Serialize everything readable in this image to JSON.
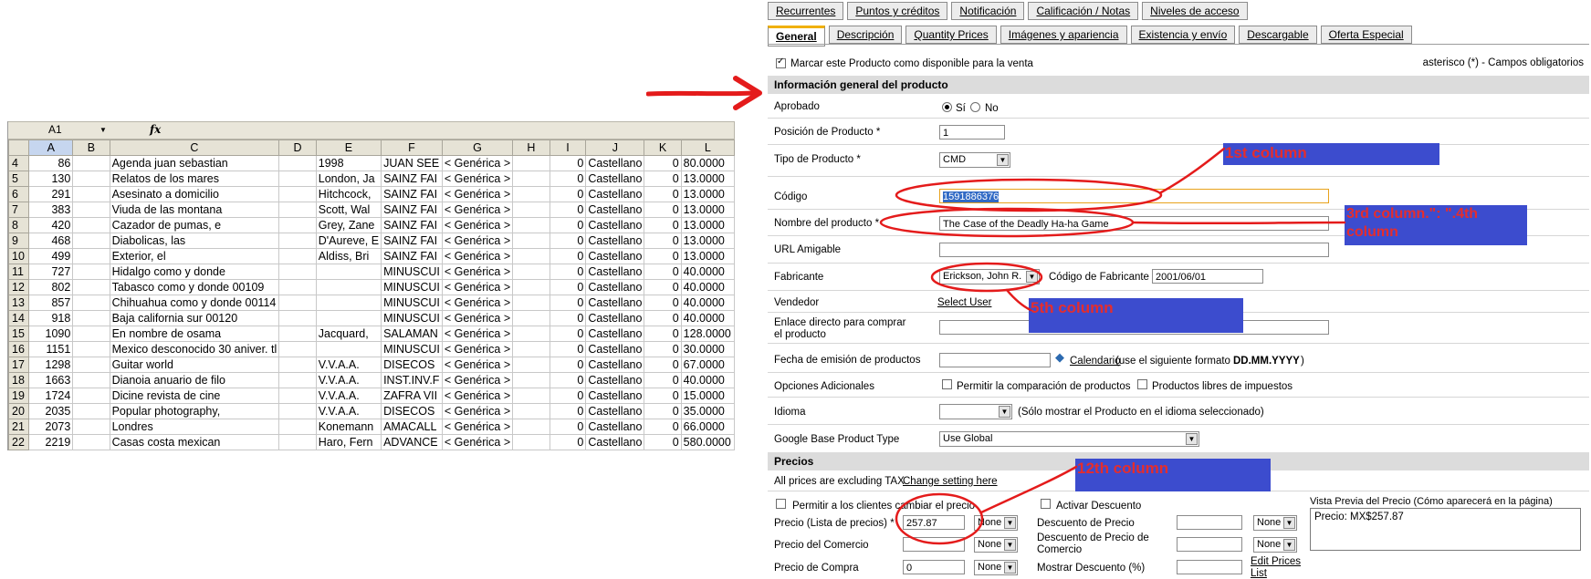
{
  "sheet": {
    "name_box": "A1",
    "fx": "fx",
    "columns": [
      "A",
      "B",
      "C",
      "D",
      "E",
      "F",
      "G",
      "H",
      "I",
      "J",
      "K",
      "L"
    ],
    "rows": [
      {
        "n": "4",
        "a": "86",
        "c": "Agenda juan sebastian",
        "e": "1998",
        "f": "JUAN SEE",
        "g": "< Genérica >",
        "i": "0",
        "j": "Castellano",
        "k": "0",
        "l": "80.0000"
      },
      {
        "n": "5",
        "a": "130",
        "c": "Relatos de los mares",
        "e": "London, Ja",
        "f": "SAINZ FAI",
        "g": "< Genérica >",
        "i": "0",
        "j": "Castellano",
        "k": "0",
        "l": "13.0000"
      },
      {
        "n": "6",
        "a": "291",
        "c": "Asesinato a domicilio",
        "e": "Hitchcock,",
        "f": "SAINZ FAI",
        "g": "< Genérica >",
        "i": "0",
        "j": "Castellano",
        "k": "0",
        "l": "13.0000"
      },
      {
        "n": "7",
        "a": "383",
        "c": "Viuda de las montana",
        "e": "Scott, Wal",
        "f": "SAINZ FAI",
        "g": "< Genérica >",
        "i": "0",
        "j": "Castellano",
        "k": "0",
        "l": "13.0000"
      },
      {
        "n": "8",
        "a": "420",
        "c": "Cazador de pumas, e",
        "e": "Grey, Zane",
        "f": "SAINZ FAI",
        "g": "< Genérica >",
        "i": "0",
        "j": "Castellano",
        "k": "0",
        "l": "13.0000"
      },
      {
        "n": "9",
        "a": "468",
        "c": "Diabolicas, las",
        "e": "D'Aureve, E",
        "f": "SAINZ FAI",
        "g": "< Genérica >",
        "i": "0",
        "j": "Castellano",
        "k": "0",
        "l": "13.0000"
      },
      {
        "n": "10",
        "a": "499",
        "c": "Exterior, el",
        "e": "Aldiss, Bri",
        "f": "SAINZ FAI",
        "g": "< Genérica >",
        "i": "0",
        "j": "Castellano",
        "k": "0",
        "l": "13.0000"
      },
      {
        "n": "11",
        "a": "727",
        "c": "Hidalgo como y donde",
        "e": "",
        "f": "MINUSCUI",
        "g": "< Genérica >",
        "i": "0",
        "j": "Castellano",
        "k": "0",
        "l": "40.0000"
      },
      {
        "n": "12",
        "a": "802",
        "c": "Tabasco como y donde 00109",
        "e": "",
        "f": "MINUSCUI",
        "g": "< Genérica >",
        "i": "0",
        "j": "Castellano",
        "k": "0",
        "l": "40.0000"
      },
      {
        "n": "13",
        "a": "857",
        "c": "Chihuahua como y donde 00114",
        "e": "",
        "f": "MINUSCUI",
        "g": "< Genérica >",
        "i": "0",
        "j": "Castellano",
        "k": "0",
        "l": "40.0000"
      },
      {
        "n": "14",
        "a": "918",
        "c": "Baja california sur 00120",
        "e": "",
        "f": "MINUSCUI",
        "g": "< Genérica >",
        "i": "0",
        "j": "Castellano",
        "k": "0",
        "l": "40.0000"
      },
      {
        "n": "15",
        "a": "1090",
        "c": "En nombre de osama",
        "e": "Jacquard,",
        "f": "SALAMAN",
        "g": "< Genérica >",
        "i": "0",
        "j": "Castellano",
        "k": "0",
        "l": "128.0000"
      },
      {
        "n": "16",
        "a": "1151",
        "c": "Mexico desconocido 30 aniver. tl",
        "e": "",
        "f": "MINUSCUI",
        "g": "< Genérica >",
        "i": "0",
        "j": "Castellano",
        "k": "0",
        "l": "30.0000"
      },
      {
        "n": "17",
        "a": "1298",
        "c": "Guitar world",
        "e": "V.V.A.A.",
        "f": "DISECOS",
        "g": "< Genérica >",
        "i": "0",
        "j": "Castellano",
        "k": "0",
        "l": "67.0000"
      },
      {
        "n": "18",
        "a": "1663",
        "c": "Dianoia anuario de filo",
        "e": "V.V.A.A.",
        "f": "INST.INV.F",
        "g": "< Genérica >",
        "i": "0",
        "j": "Castellano",
        "k": "0",
        "l": "40.0000"
      },
      {
        "n": "19",
        "a": "1724",
        "c": "Dicine revista de cine",
        "e": "V.V.A.A.",
        "f": "ZAFRA VII",
        "g": "< Genérica >",
        "i": "0",
        "j": "Castellano",
        "k": "0",
        "l": "15.0000"
      },
      {
        "n": "20",
        "a": "2035",
        "c": "Popular photography,",
        "e": "V.V.A.A.",
        "f": "DISECOS",
        "g": "< Genérica >",
        "i": "0",
        "j": "Castellano",
        "k": "0",
        "l": "35.0000"
      },
      {
        "n": "21",
        "a": "2073",
        "c": "Londres",
        "e": "Konemann",
        "f": "AMACALL",
        "g": "< Genérica >",
        "i": "0",
        "j": "Castellano",
        "k": "0",
        "l": "66.0000"
      },
      {
        "n": "22",
        "a": "2219",
        "c": "Casas costa mexican",
        "e": "Haro, Fern",
        "f": "ADVANCE",
        "g": "< Genérica >",
        "i": "0",
        "j": "Castellano",
        "k": "0",
        "l": "580.0000"
      }
    ]
  },
  "form": {
    "tabs_row1": [
      "Recurrentes",
      "Puntos y créditos",
      "Notificación",
      "Calificación / Notas",
      "Niveles de acceso"
    ],
    "tabs_row2": [
      "General",
      "Descripción",
      "Quantity Prices",
      "Imágenes y apariencia",
      "Existencia y envío",
      "Descargable",
      "Oferta Especial"
    ],
    "available_label": "Marcar este Producto como disponible para la venta",
    "required_note": "asterisco (*) - Campos obligatorios",
    "section_general": "Información general del producto",
    "aprobado": "Aprobado",
    "si": "Sí",
    "no": "No",
    "posicion_label": "Posición de Producto *",
    "posicion_value": "1",
    "tipo_label": "Tipo de Producto *",
    "tipo_value": "CMD",
    "codigo_label": "Código",
    "codigo_value": "1591886376",
    "nombre_label": "Nombre del producto *",
    "nombre_value": "The Case of the Deadly Ha-ha Game",
    "url_label": "URL Amigable",
    "fabricante_label": "Fabricante",
    "fabricante_value": "Erickson, John R.",
    "codigo_fab_label": "Código de Fabricante",
    "codigo_fab_value": "2001/06/01",
    "vendedor_label": "Vendedor",
    "select_user": "Select User",
    "enlace_label": "Enlace directo para comprar el producto",
    "fecha_label": "Fecha de emisión de productos",
    "calendario": "Calendario",
    "fecha_hint": "(use el siguiente formato",
    "fecha_format": "DD.MM.YYYY",
    "fecha_close": ")",
    "opciones_label": "Opciones Adicionales",
    "comparar": "Permitir la comparación de productos",
    "libres": "Productos libres de impuestos",
    "idioma_label": "Idioma",
    "idioma_hint": "(Sólo mostrar el Producto en el idioma seleccionado)",
    "google_label": "Google Base Product Type",
    "google_value": "Use Global",
    "section_precios": "Precios",
    "tax_note": "All prices are excluding TAX",
    "change_setting": "Change setting here",
    "permitir_cambiar": "Permitir a los clientes cambiar el precio",
    "activar_descuento": "Activar Descuento",
    "vista_previa": "Vista Previa del Precio (Cómo aparecerá en la página)",
    "precio_lista_label": "Precio (Lista de precios) *",
    "precio_lista_value": "257.87",
    "none": "None",
    "descuento_precio": "Descuento de Precio",
    "precio_preview": "Precio:  MX$257.87",
    "precio_comercio_label": "Precio del Comercio",
    "descuento_comercio": "Descuento de Precio de Comercio",
    "precio_compra_label": "Precio de Compra",
    "precio_compra_value": "0",
    "mostrar_descuento": "Mostrar Descuento (%)",
    "edit_prices": "Edit Prices",
    "edit_prices_2": "List"
  },
  "annotations": {
    "c1": "1st column",
    "c3": "3rd column.\": \".4th column",
    "c5": "5th column",
    "c12": "12th column"
  },
  "colors": {
    "annotation_bg": "#3c4cce",
    "annotation_text": "#e52d2d",
    "circle": "#e41b1b"
  }
}
